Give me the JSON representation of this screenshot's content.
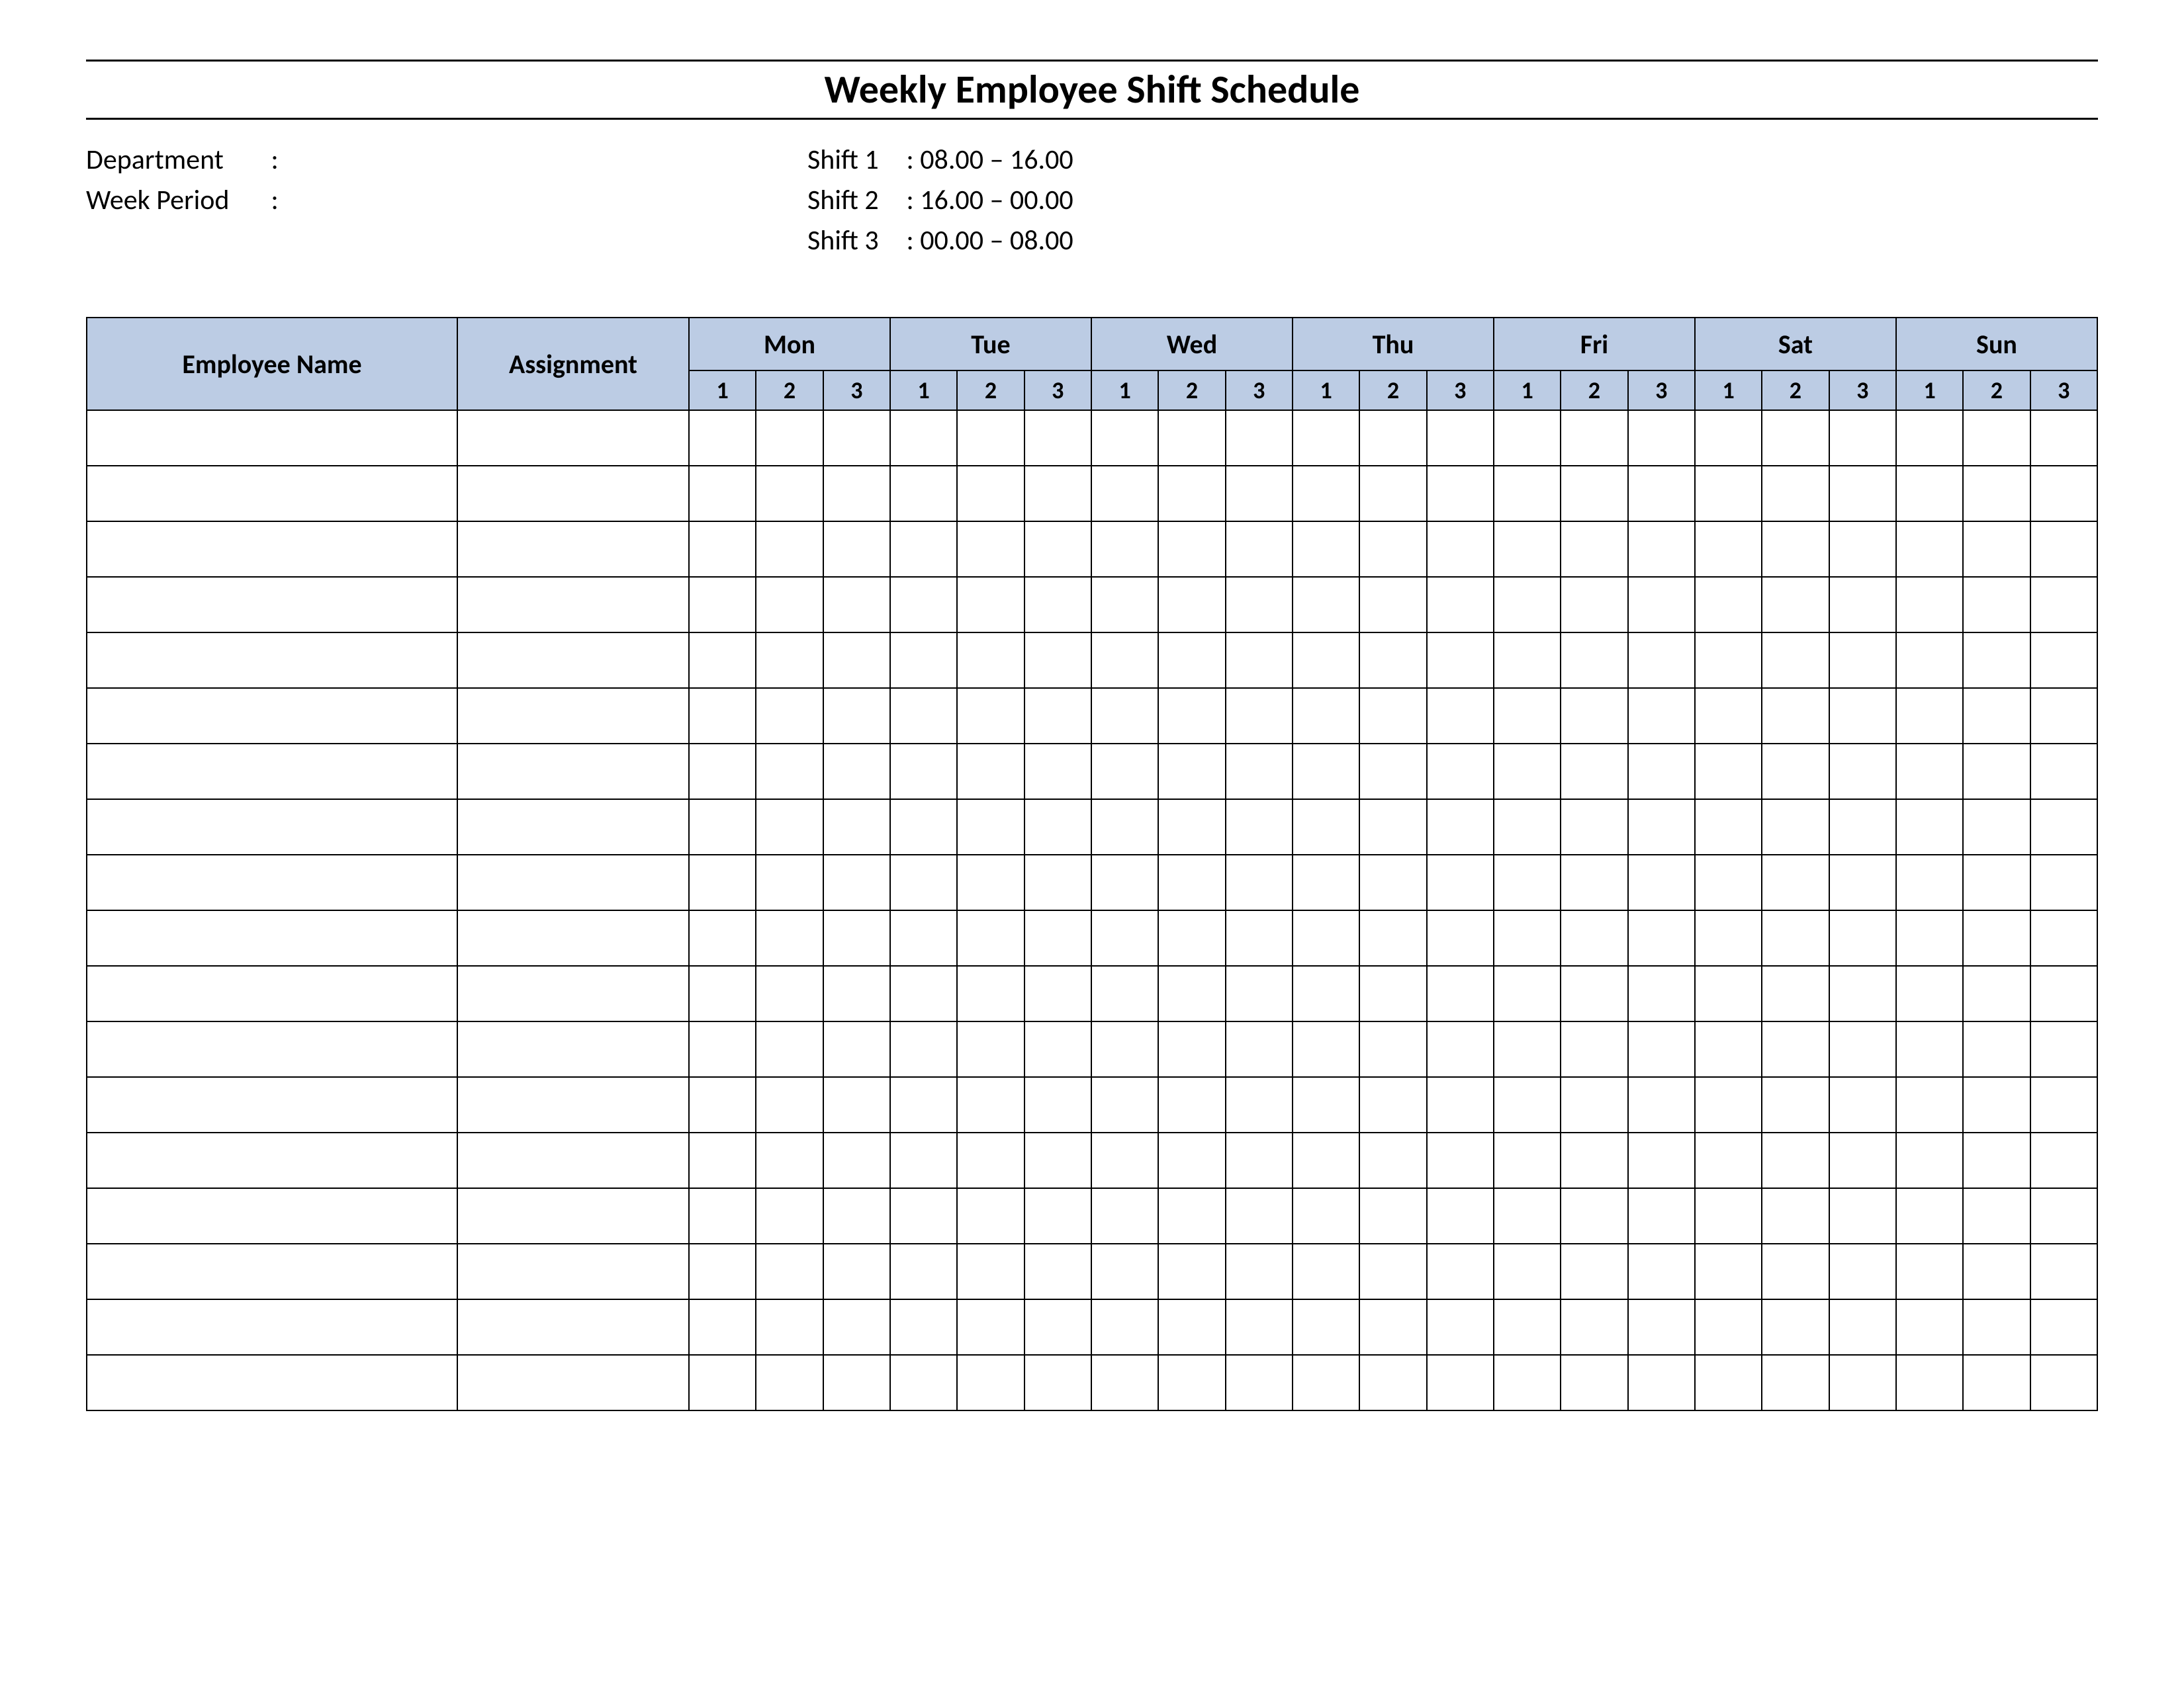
{
  "title": "Weekly Employee Shift Schedule",
  "meta": {
    "department_label": "Department",
    "department_value": "",
    "week_period_label": "Week  Period",
    "week_period_value": "",
    "separator": ":"
  },
  "shifts": [
    {
      "label": "Shift 1",
      "time": "08.00  – 16.00"
    },
    {
      "label": "Shift 2",
      "time": "16.00  – 00.00"
    },
    {
      "label": "Shift 3",
      "time": "00.00  – 08.00"
    }
  ],
  "table": {
    "headers": {
      "employee_name": "Employee Name",
      "assignment": "Assignment",
      "days": [
        "Mon",
        "Tue",
        "Wed",
        "Thu",
        "Fri",
        "Sat",
        "Sun"
      ],
      "shift_subheaders": [
        "1",
        "2",
        "3"
      ]
    },
    "row_count": 18
  }
}
